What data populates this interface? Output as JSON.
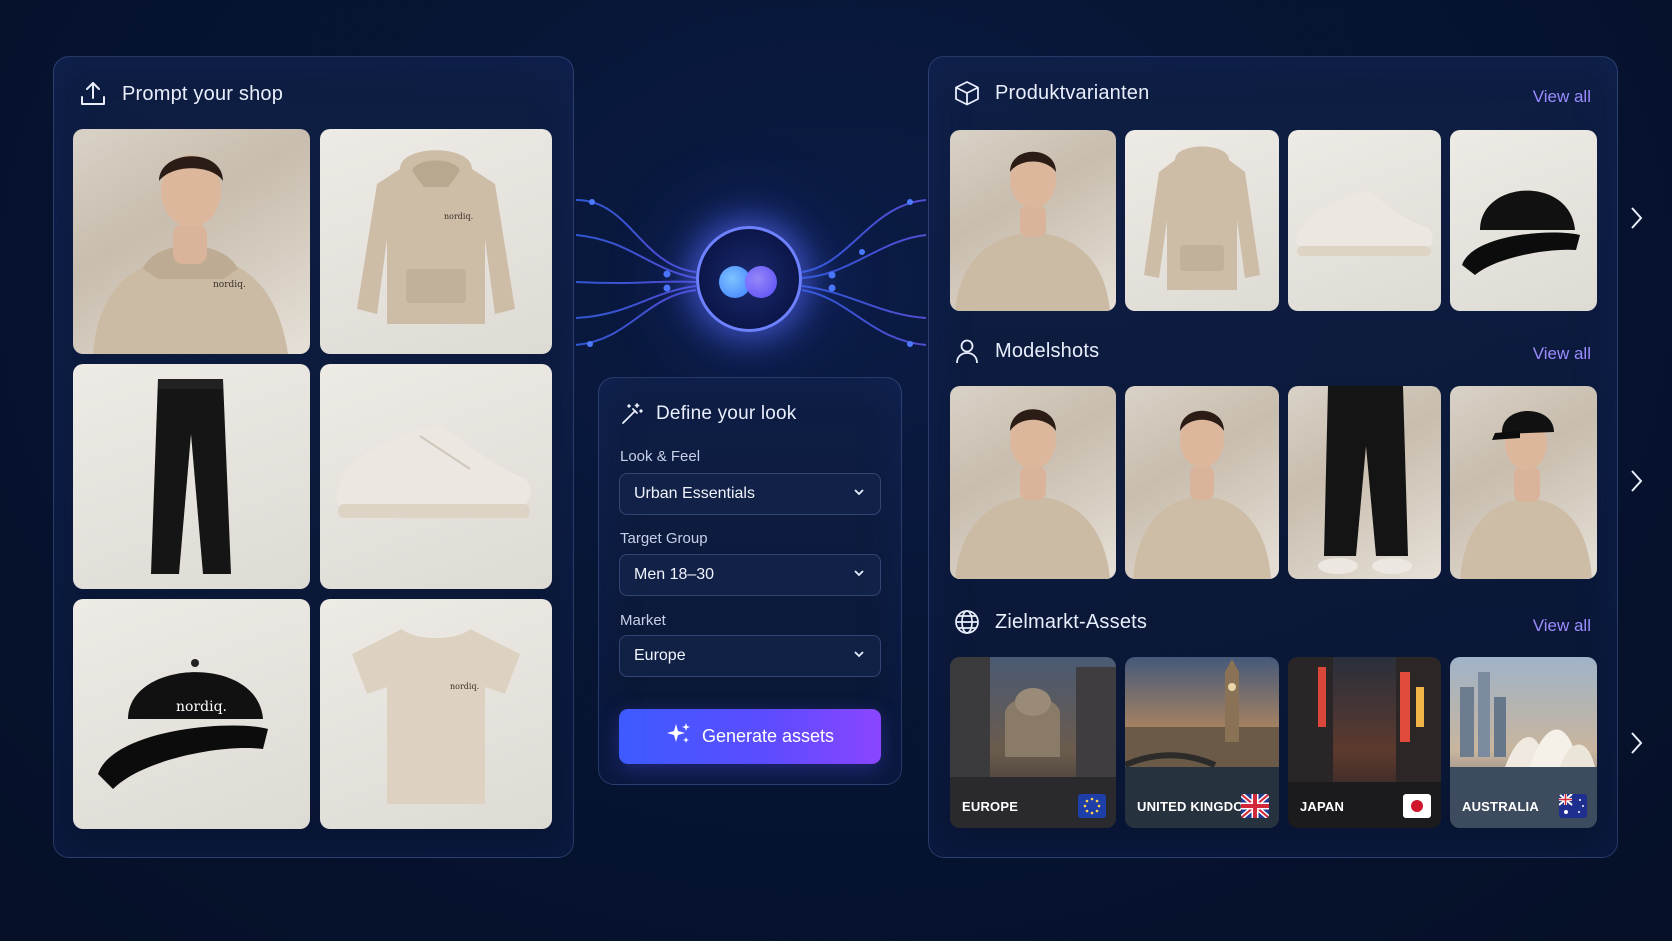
{
  "left_panel": {
    "title": "Prompt your shop",
    "icon": "upload-icon",
    "products": [
      {
        "name": "model-hoodie",
        "logo": "nordiq."
      },
      {
        "name": "hoodie",
        "logo": "nordiq."
      },
      {
        "name": "trousers"
      },
      {
        "name": "sneaker"
      },
      {
        "name": "cap",
        "logo": "nordiq."
      },
      {
        "name": "tshirt",
        "logo": "nordiq."
      }
    ]
  },
  "define_panel": {
    "title": "Define your look",
    "icon": "magic-wand-icon",
    "fields": [
      {
        "label": "Look & Feel",
        "value": "Urban Essentials"
      },
      {
        "label": "Target Group",
        "value": "Men 18–30"
      },
      {
        "label": "Market",
        "value": "Europe"
      }
    ],
    "button_label": "Generate assets"
  },
  "right_panel": {
    "sections": [
      {
        "title": "Produktvarianten",
        "icon": "box-icon",
        "view_all": "View all"
      },
      {
        "title": "Modelshots",
        "icon": "user-icon",
        "view_all": "View all"
      },
      {
        "title": "Zielmarkt-Assets",
        "icon": "globe-icon",
        "view_all": "View all"
      }
    ],
    "markets": [
      {
        "label": "EUROPE",
        "flag": "eu-flag"
      },
      {
        "label": "UNITED KINGDOM",
        "flag": "uk-flag"
      },
      {
        "label": "JAPAN",
        "flag": "japan-flag"
      },
      {
        "label": "AUSTRALIA",
        "flag": "australia-flag"
      }
    ]
  },
  "colors": {
    "background": "#071533",
    "accent_link": "#9c8cff",
    "button_start": "#3d5bff",
    "button_end": "#8a45ff",
    "glow": "#6e82ff"
  }
}
